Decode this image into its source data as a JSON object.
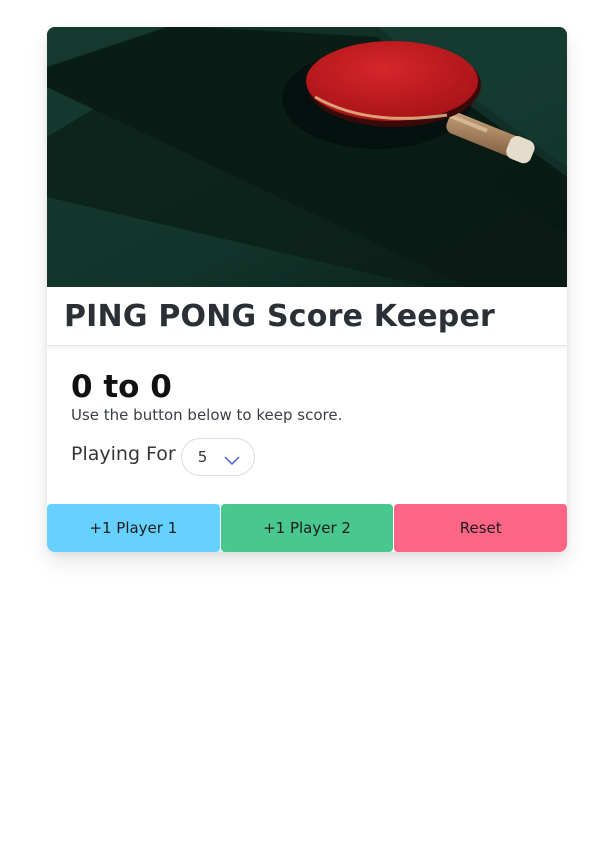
{
  "header": {
    "title": "PING PONG Score Keeper"
  },
  "scoreboard": {
    "score_text": "0 to 0",
    "instructions": "Use the button below to keep score."
  },
  "settings": {
    "playing_for_label": "Playing For",
    "selected_value": "5"
  },
  "actions": {
    "player1_label": "+1 Player 1",
    "player2_label": "+1 Player 2",
    "reset_label": "Reset"
  },
  "colors": {
    "player1": "#66d1ff",
    "player2": "#48c78e",
    "reset": "#ff6685"
  },
  "icons": {
    "select_arrow": "chevron-down-icon"
  }
}
